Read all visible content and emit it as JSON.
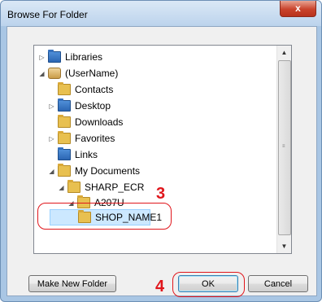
{
  "window": {
    "title": "Browse For Folder",
    "close_glyph": "x"
  },
  "tree": {
    "items": [
      {
        "label": "Libraries",
        "icon": "libraries-icon",
        "expander": "▷"
      },
      {
        "label": "(UserName)",
        "icon": "user-folder-icon",
        "expander": "◢"
      },
      {
        "label": "Contacts",
        "icon": "contacts-folder-icon",
        "expander": ""
      },
      {
        "label": "Desktop",
        "icon": "desktop-folder-icon",
        "expander": "▷"
      },
      {
        "label": "Downloads",
        "icon": "downloads-folder-icon",
        "expander": ""
      },
      {
        "label": "Favorites",
        "icon": "favorites-folder-icon",
        "expander": "▷"
      },
      {
        "label": "Links",
        "icon": "links-folder-icon",
        "expander": ""
      },
      {
        "label": "My Documents",
        "icon": "documents-folder-icon",
        "expander": "◢"
      },
      {
        "label": "SHARP_ECR",
        "icon": "folder-icon",
        "expander": "◢"
      },
      {
        "label": "A207U",
        "icon": "folder-icon",
        "expander": "◢"
      },
      {
        "label": "SHOP_NAME1",
        "icon": "folder-icon",
        "expander": "",
        "selected": true
      }
    ],
    "scroll_up": "▲",
    "scroll_down": "▼"
  },
  "buttons": {
    "make_new_folder": "Make New Folder",
    "ok": "OK",
    "cancel": "Cancel"
  },
  "annotations": {
    "step_3": "3",
    "step_4": "4"
  },
  "colors": {
    "annotation_red": "#e0161c",
    "selection": "#cce8ff",
    "close_button": "#c9432c"
  }
}
